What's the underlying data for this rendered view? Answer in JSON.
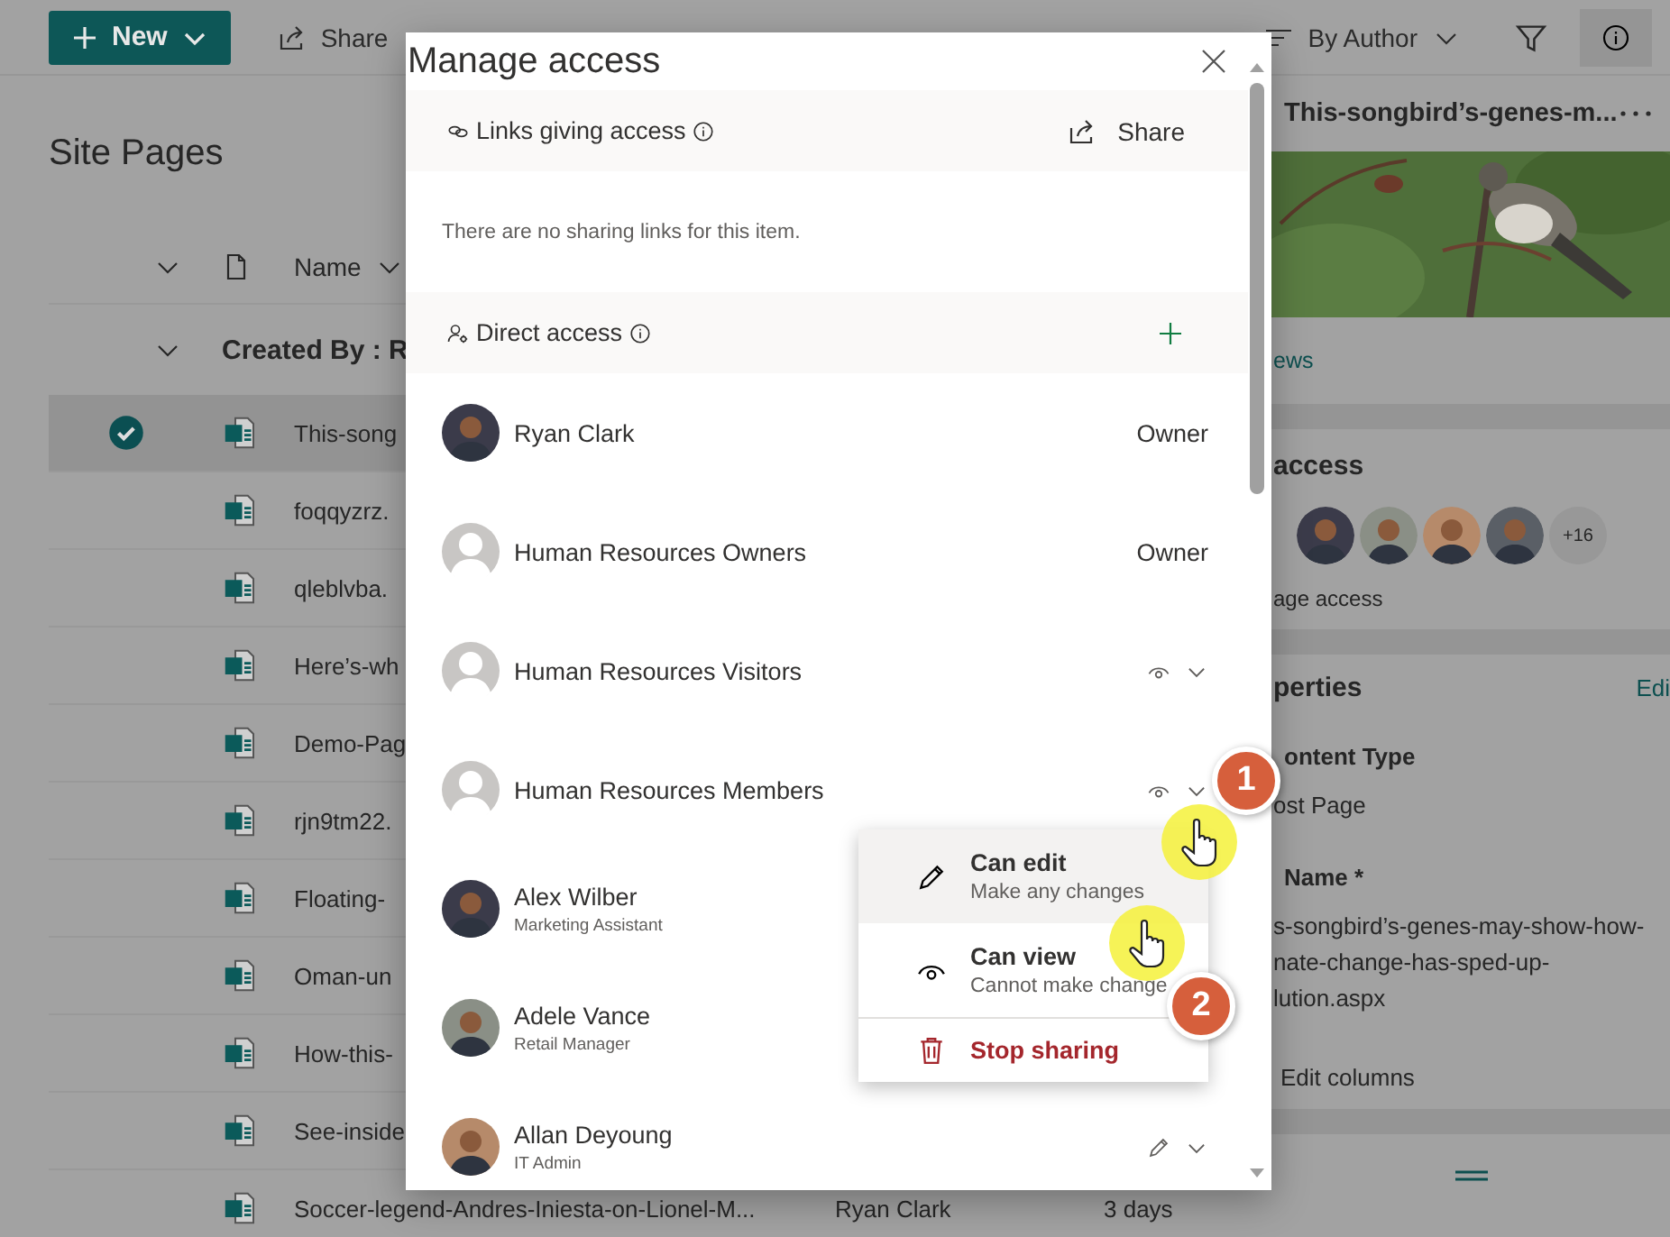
{
  "toolbar": {
    "new_label": "New",
    "share_label": "Share",
    "sort_label": "By Author"
  },
  "library": {
    "title": "Site Pages",
    "name_column": "Name",
    "group_header": "Created By : R",
    "rows": [
      {
        "name": "This-song",
        "selected": true
      },
      {
        "name": "foqqyzrz.",
        "selected": false
      },
      {
        "name": "qleblvba.",
        "selected": false
      },
      {
        "name": "Here’s-wh",
        "selected": false
      },
      {
        "name": "Demo-Pag",
        "selected": false
      },
      {
        "name": "rjn9tm22.",
        "selected": false
      },
      {
        "name": "Floating-",
        "selected": false
      },
      {
        "name": "Oman-un",
        "selected": false
      },
      {
        "name": "How-this-",
        "selected": false
      },
      {
        "name": "See-inside",
        "selected": false
      },
      {
        "name": "Soccer-legend-Andres-Iniesta-on-Lionel-M...",
        "author": "Ryan Clark",
        "modified": "3 days",
        "selected": false
      }
    ]
  },
  "details_pane": {
    "title": "This-songbird’s-genes-m...",
    "views_link": "ews",
    "access_heading": "access",
    "more_count": "+16",
    "manage_link": "age access",
    "properties_heading": "perties",
    "edit_link": "Edi",
    "fields": [
      {
        "label": "ontent Type",
        "lines": [
          "ost Page"
        ]
      },
      {
        "label": "Name *",
        "lines": [
          "s-songbird’s-genes-may-show-how-",
          "nate-change-has-sped-up-",
          "lution.aspx"
        ]
      }
    ],
    "edit_columns": "Edit columns"
  },
  "dialog": {
    "title": "Manage access",
    "links_section": {
      "heading": "Links giving access",
      "share_label": "Share",
      "empty_message": "There are no sharing links for this item."
    },
    "direct_section": {
      "heading": "Direct access"
    },
    "people": [
      {
        "name": "Ryan Clark",
        "access": {
          "kind": "role",
          "label": "Owner"
        }
      },
      {
        "name": "Human Resources Owners",
        "avatar": {
          "kind": "placeholder"
        },
        "access": {
          "kind": "role",
          "label": "Owner"
        }
      },
      {
        "name": "Human Resources Visitors",
        "avatar": {
          "kind": "placeholder"
        },
        "access": {
          "kind": "view"
        }
      },
      {
        "name": "Human Resources Members",
        "avatar": {
          "kind": "placeholder"
        },
        "access": {
          "kind": "view"
        }
      },
      {
        "name": "Alex Wilber",
        "subtitle": "Marketing Assistant"
      },
      {
        "name": "Adele Vance",
        "subtitle": "Retail Manager"
      },
      {
        "name": "Allan Deyoung",
        "subtitle": "IT Admin",
        "access": {
          "kind": "edit"
        }
      }
    ],
    "permission_menu": {
      "items": [
        {
          "kind": "edit",
          "label": "Can edit",
          "description": "Make any changes",
          "selected": true
        },
        {
          "kind": "view",
          "label": "Can view",
          "description": "Cannot make change",
          "selected": false
        },
        {
          "kind": "stop",
          "label": "Stop sharing",
          "selected": false
        }
      ]
    }
  },
  "callouts": [
    {
      "number": "1"
    },
    {
      "number": "2"
    }
  ]
}
